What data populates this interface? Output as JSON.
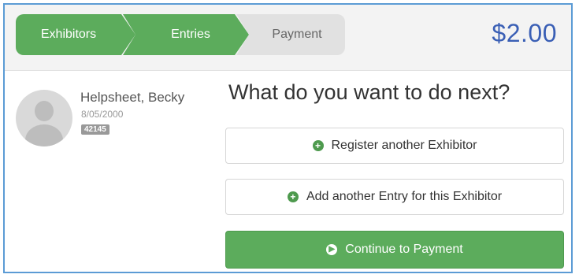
{
  "wizard": {
    "steps": [
      {
        "label": "Exhibitors"
      },
      {
        "label": "Entries"
      },
      {
        "label": "Payment"
      }
    ],
    "total": "$2.00"
  },
  "exhibitor": {
    "name": "Helpsheet, Becky",
    "dob": "8/05/2000",
    "id": "42145"
  },
  "main": {
    "question": "What do you want to do next?",
    "register_label": "Register another Exhibitor",
    "add_entry_label": "Add another Entry for this Exhibitor",
    "continue_label": "Continue to Payment"
  },
  "colors": {
    "accent_green": "#5cac5c",
    "total_blue": "#3a5fb5",
    "frame_blue": "#5b9bd5"
  },
  "icons": {
    "register": "plus-circle-icon",
    "add_entry": "plus-circle-icon",
    "continue": "arrow-circle-right-icon",
    "avatar": "user-placeholder-icon"
  }
}
